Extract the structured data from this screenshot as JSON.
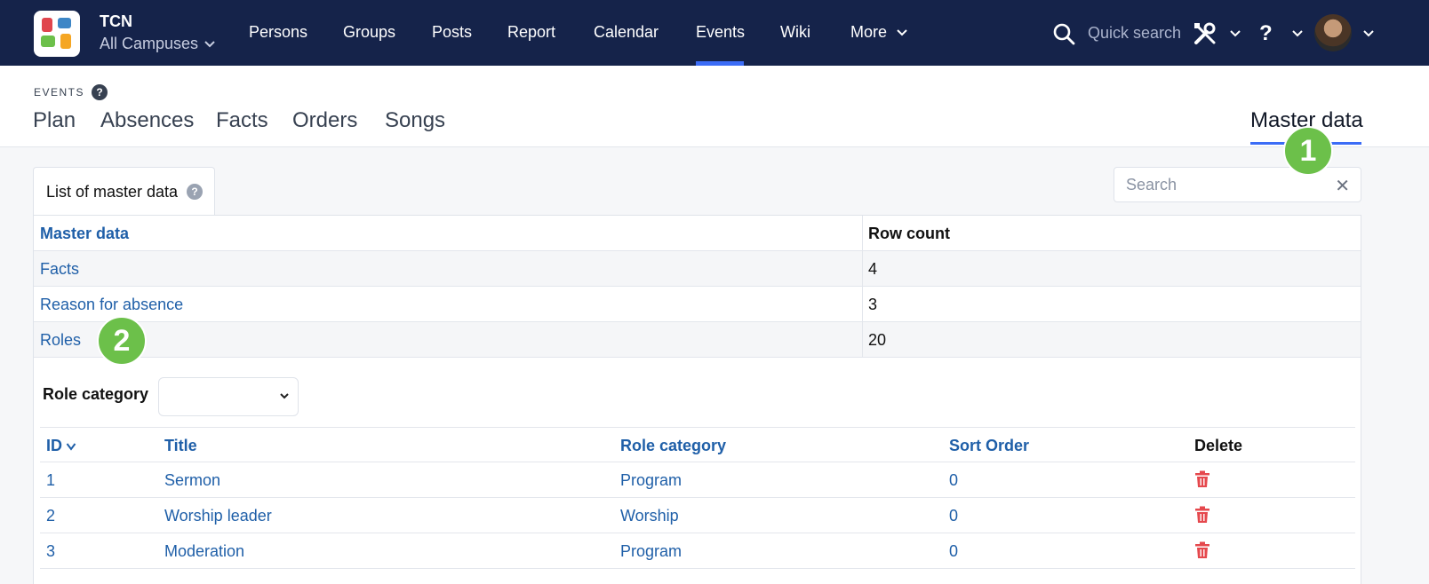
{
  "brand": {
    "name": "TCN",
    "campus": "All Campuses"
  },
  "nav": {
    "items": [
      "Persons",
      "Groups",
      "Posts",
      "Report",
      "Calendar",
      "Events",
      "Wiki",
      "More"
    ],
    "active": "Events",
    "quick_search": "Quick search"
  },
  "subheader": {
    "section": "EVENTS",
    "tabs": [
      "Plan",
      "Absences",
      "Facts",
      "Orders",
      "Songs"
    ],
    "active_tab": "Master data"
  },
  "markers": [
    "1",
    "2"
  ],
  "list_tab": {
    "label": "List of master data"
  },
  "search": {
    "placeholder": "Search"
  },
  "master_table": {
    "headers": [
      "Master data",
      "Row count"
    ],
    "rows": [
      {
        "name": "Facts",
        "count": "4"
      },
      {
        "name": "Reason for absence",
        "count": "3"
      },
      {
        "name": "Roles",
        "count": "20"
      }
    ]
  },
  "roles": {
    "filter_label": "Role category",
    "headers": {
      "id": "ID",
      "title": "Title",
      "category": "Role category",
      "sort": "Sort Order",
      "delete": "Delete"
    },
    "rows": [
      {
        "id": "1",
        "title": "Sermon",
        "category": "Program",
        "sort": "0"
      },
      {
        "id": "2",
        "title": "Worship leader",
        "category": "Worship",
        "sort": "0"
      },
      {
        "id": "3",
        "title": "Moderation",
        "category": "Program",
        "sort": "0"
      }
    ]
  },
  "colors": {
    "nav_bg": "#15234a",
    "accent": "#3b6cf6",
    "link": "#1f5fa8",
    "marker": "#6cc04a",
    "danger": "#e5484d"
  }
}
